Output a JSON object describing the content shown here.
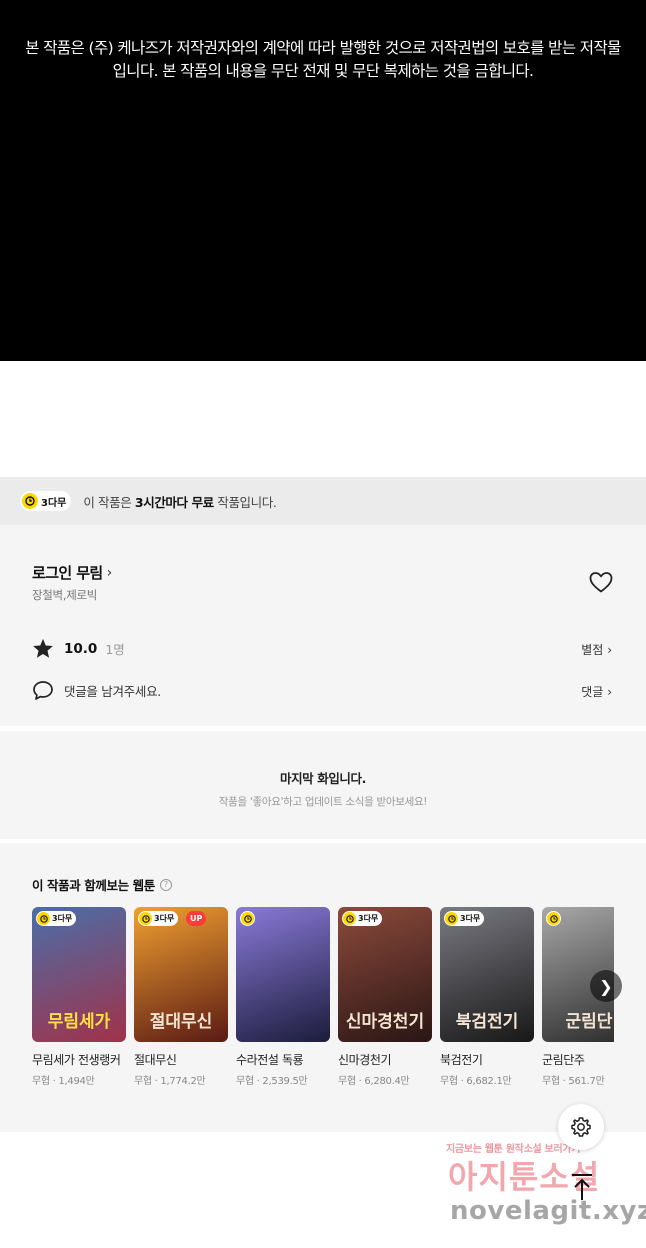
{
  "copyright_notice": "본 작품은 (주) 케나즈가 저작권자와의 계약에 따라 발행한 것으로 저작권법의 보호를 받는 저작물입니다. 본 작품의 내용을 무단 전재 및 무단 복제하는 것을 금합니다.",
  "free_bar": {
    "badge": "3다무",
    "prefix": "이 작품은 ",
    "bold": "3시간마다 무료",
    "suffix": " 작품입니다."
  },
  "work": {
    "title": "로그인 무림",
    "authors": "장철벽,제로빅",
    "rating": "10.0",
    "rating_count": "1명",
    "rate_link": "별점",
    "comment_prompt": "댓글을 남겨주세요.",
    "comment_link": "댓글"
  },
  "last_episode": {
    "heading": "마지막 화입니다.",
    "sub": "작품을 '좋아요'하고 업데이트 소식을 받아보세요!"
  },
  "recommendations": {
    "title": "이 작품과 함께보는 웹툰",
    "help": "?",
    "items": [
      {
        "name": "무림세가 전생랭커",
        "meta": "무협 · 1,494만",
        "badge": "3다무",
        "up": "",
        "logo": "무림세가",
        "colors": [
          "#4a6ea8",
          "#a0324a"
        ]
      },
      {
        "name": "절대무신",
        "meta": "무협 · 1,774.2만",
        "badge": "3다무",
        "up": "UP",
        "logo": "절대무신",
        "colors": [
          "#f0a030",
          "#5a1a14"
        ]
      },
      {
        "name": "수라전설 독룡",
        "meta": "무협 · 2,539.5만",
        "badge": "",
        "up": "",
        "logo": "",
        "colors": [
          "#8a7ad8",
          "#1c1c3c"
        ]
      },
      {
        "name": "신마경천기",
        "meta": "무협 · 6,280.4만",
        "badge": "3다무",
        "up": "",
        "logo": "신마경천기",
        "colors": [
          "#8c4a3c",
          "#2a1614"
        ]
      },
      {
        "name": "북검전기",
        "meta": "무협 · 6,682.1만",
        "badge": "3다무",
        "up": "",
        "logo": "북검전기",
        "colors": [
          "#7a7a82",
          "#181818"
        ]
      },
      {
        "name": "군림단주",
        "meta": "무협 · 561.7만",
        "badge": "",
        "up": "",
        "logo": "군림단",
        "colors": [
          "#a8a8a8",
          "#2a2a2a"
        ]
      }
    ],
    "next_icon": "chevron-right-icon"
  },
  "floating": {
    "settings_icon": "gear-icon",
    "top_icon": "arrow-up-icon"
  },
  "watermark": {
    "line1": "지금보는 웹툰 원작소설 보러가기",
    "line2": "아지툰소설",
    "line3": "novelagit.xyz"
  },
  "colors": {
    "badge_yellow": "#ffd600",
    "up_red": "#ff3b3b",
    "panel_bg": "#f5f5f5",
    "freebar_bg": "#ebebeb"
  }
}
